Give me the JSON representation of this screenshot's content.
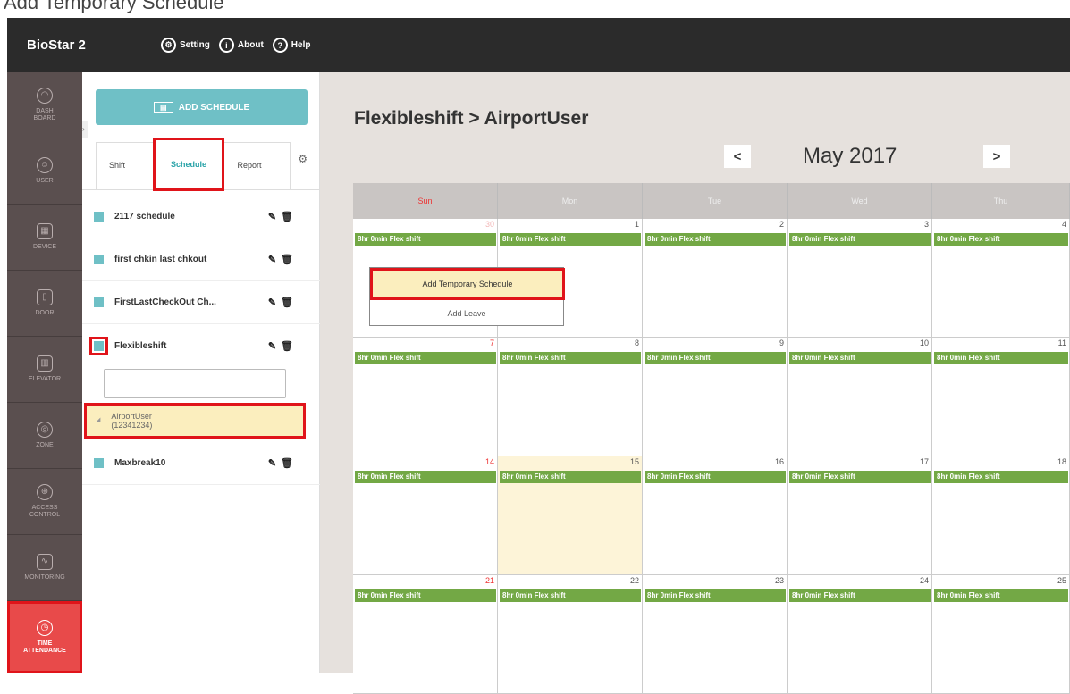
{
  "caption": "Add Temporary Schedule",
  "app": {
    "brand": "BioStar 2",
    "top_links": [
      {
        "label": "Setting",
        "icon": "gear-icon"
      },
      {
        "label": "About",
        "icon": "info-icon"
      },
      {
        "label": "Help",
        "icon": "help-icon"
      }
    ]
  },
  "nav": [
    {
      "line1": "DASH",
      "line2": "BOARD",
      "icon": "dashboard-icon"
    },
    {
      "line1": "USER",
      "line2": "",
      "icon": "user-icon"
    },
    {
      "line1": "DEVICE",
      "line2": "",
      "icon": "device-icon"
    },
    {
      "line1": "DOOR",
      "line2": "",
      "icon": "door-icon"
    },
    {
      "line1": "ELEVATOR",
      "line2": "",
      "icon": "elevator-icon"
    },
    {
      "line1": "ZONE",
      "line2": "",
      "icon": "zone-icon"
    },
    {
      "line1": "ACCESS",
      "line2": "CONTROL",
      "icon": "access-control-icon"
    },
    {
      "line1": "MONITORING",
      "line2": "",
      "icon": "monitoring-icon"
    },
    {
      "line1": "TIME",
      "line2": "ATTENDANCE",
      "icon": "clock-icon"
    }
  ],
  "panel": {
    "add_button": "ADD SCHEDULE",
    "tabs": [
      "Shift",
      "Schedule",
      "Report"
    ],
    "schedules": [
      "2117 schedule",
      "first chkin last chkout",
      "FirstLastCheckOut Ch...",
      "Flexibleshift",
      "Maxbreak10"
    ],
    "user": {
      "name": "AirportUser",
      "id": "(12341234)"
    }
  },
  "main": {
    "title": "Flexibleshift > AirportUser",
    "month": "May 2017",
    "prev": "<",
    "next": ">",
    "days": [
      "Sun",
      "Mon",
      "Tue",
      "Wed",
      "Thu"
    ],
    "shift_label": "8hr 0min Flex shift",
    "weeks": [
      [
        "30",
        "1",
        "2",
        "3",
        "4"
      ],
      [
        "7",
        "8",
        "9",
        "10",
        "11"
      ],
      [
        "14",
        "15",
        "16",
        "17",
        "18"
      ],
      [
        "21",
        "22",
        "23",
        "24",
        "25"
      ]
    ],
    "context_menu": [
      "Add Temporary Schedule",
      "Add Leave"
    ]
  }
}
